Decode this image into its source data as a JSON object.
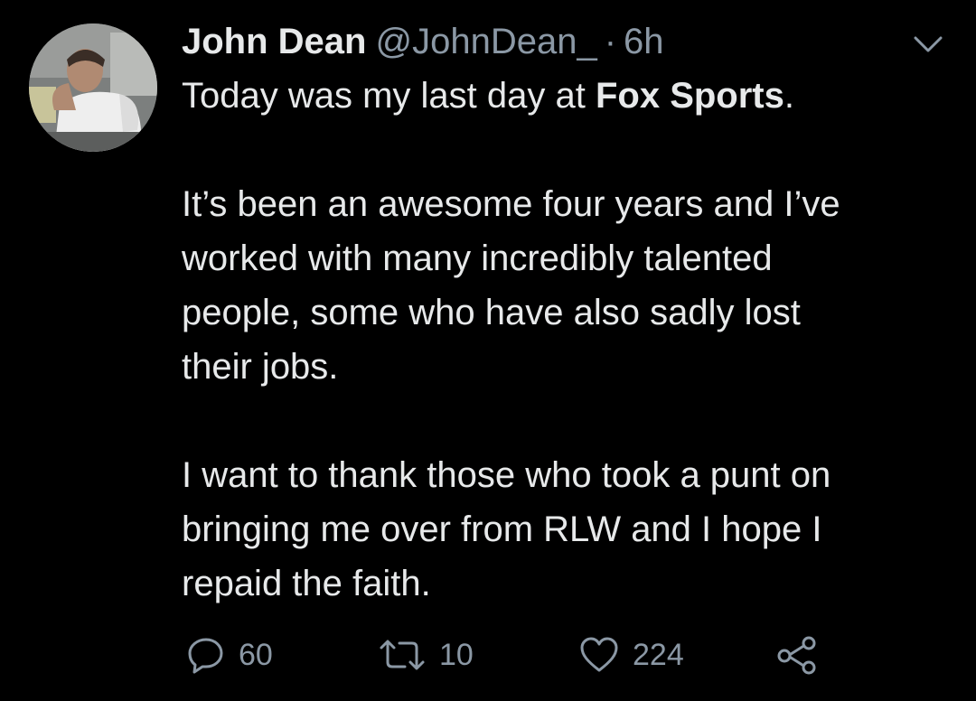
{
  "tweet": {
    "author_name": "John Dean",
    "handle": "@JohnDean_",
    "separator": "·",
    "time": "6h",
    "text": {
      "line1_before": "Today was my last day at ",
      "line1_bold": "Fox Sports",
      "line1_after": ".",
      "para2_line1": "It’s been an awesome four years and I’ve",
      "para2_line2": "worked with many incredibly talented",
      "para2_line3": "people, some who have also sadly lost",
      "para2_line4": "their jobs.",
      "para3_line1": "I want to thank those who took a punt on",
      "para3_line2": "bringing me over from RLW and I hope I",
      "para3_line3": "repaid the faith."
    }
  },
  "actions": {
    "reply_count": "60",
    "retweet_count": "10",
    "like_count": "224"
  },
  "icons": {
    "menu": "chevron-down-icon",
    "reply": "reply-icon",
    "retweet": "retweet-icon",
    "like": "heart-icon",
    "share": "share-icon"
  },
  "colors": {
    "background": "#000000",
    "primary_text": "#e7e9ea",
    "secondary_text": "#8b98a5"
  }
}
